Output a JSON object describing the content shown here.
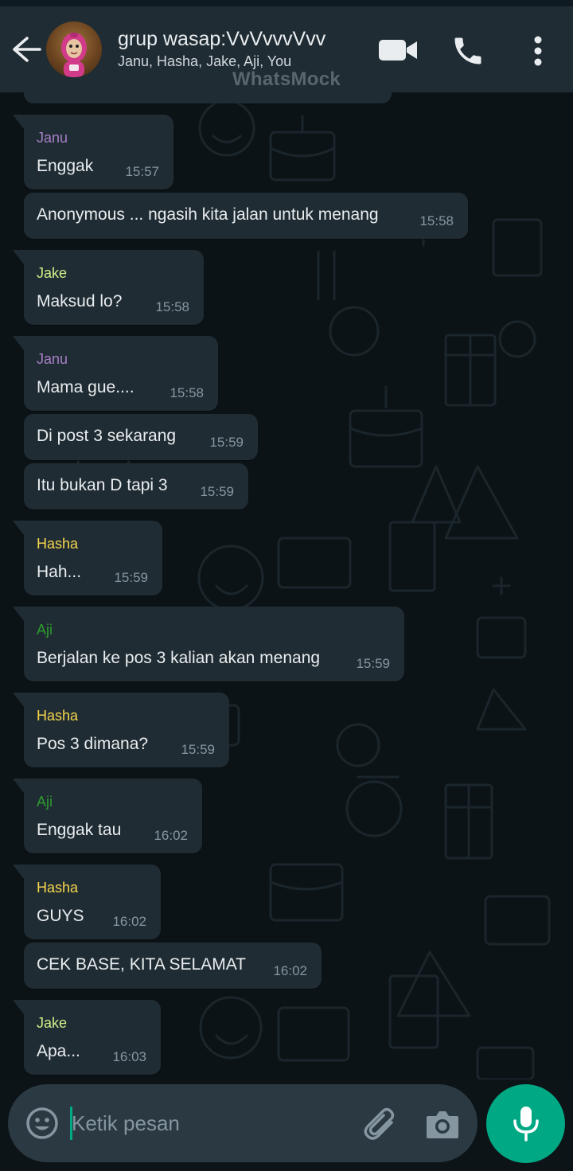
{
  "header": {
    "title": "grup wasap:VvVvvvVvv",
    "subtitle": "Janu, Hasha, Jake, Aji, You",
    "watermark": "WhatsMock"
  },
  "icons": {
    "back": "arrow-left-icon",
    "video": "video-camera-icon",
    "call": "phone-icon",
    "menu": "more-vertical-icon",
    "emoji": "emoji-icon",
    "attach": "paperclip-icon",
    "camera": "camera-icon",
    "mic": "microphone-icon"
  },
  "colors": {
    "accent": "#00a884",
    "header_bg": "#1f2c33",
    "bubble_bg": "#202c33",
    "chat_bg": "#0c1317",
    "janu": "#a77fc8",
    "jake": "#d3ee8b",
    "hasha": "#f6d54e",
    "aji": "#2e9b2e"
  },
  "messages": [
    {
      "sender": "Janu",
      "text": "Enggak",
      "time": "15:57"
    },
    {
      "sender": "",
      "text": "Anonymous ... ngasih kita jalan untuk menang",
      "time": "15:58"
    },
    {
      "sender": "Jake",
      "text": "Maksud lo?",
      "time": "15:58"
    },
    {
      "sender": "Janu",
      "text": "Mama gue....",
      "time": "15:58"
    },
    {
      "sender": "",
      "text": "Di post 3 sekarang",
      "time": "15:59"
    },
    {
      "sender": "",
      "text": "Itu bukan D tapi 3",
      "time": "15:59"
    },
    {
      "sender": "Hasha",
      "text": "Hah...",
      "time": "15:59"
    },
    {
      "sender": "Aji",
      "text": "Berjalan ke pos 3 kalian akan menang",
      "time": "15:59"
    },
    {
      "sender": "Hasha",
      "text": "Pos 3 dimana?",
      "time": "15:59"
    },
    {
      "sender": "Aji",
      "text": "Enggak tau",
      "time": "16:02"
    },
    {
      "sender": "Hasha",
      "text": "GUYS",
      "time": "16:02"
    },
    {
      "sender": "",
      "text": "CEK BASE, KITA SELAMAT",
      "time": "16:02"
    },
    {
      "sender": "Jake",
      "text": "Apa...",
      "time": "16:03"
    }
  ],
  "composer": {
    "placeholder": "Ketik pesan",
    "value": ""
  }
}
